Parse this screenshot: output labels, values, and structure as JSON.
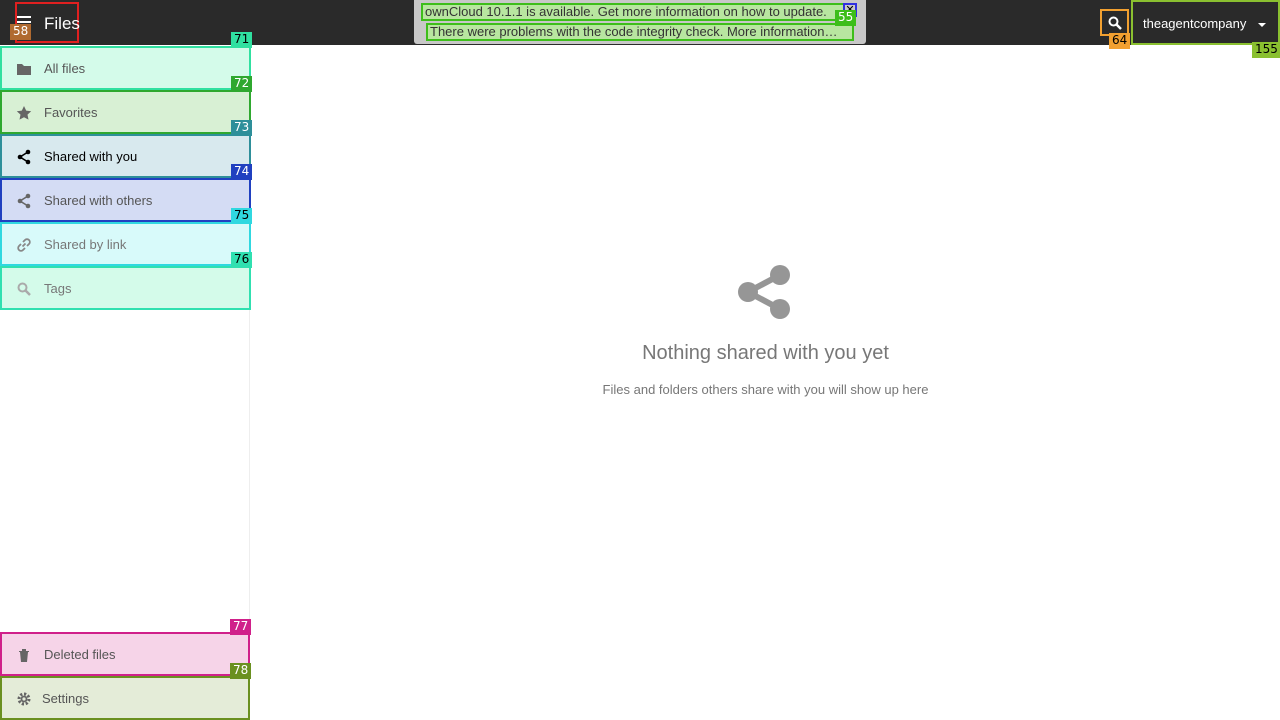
{
  "header": {
    "app_title": "Files",
    "notifications": [
      "ownCloud 10.1.1 is available. Get more information on how to update.",
      "There were problems with the code integrity check. More information…"
    ],
    "close_glyph": "✕",
    "username": "theagentcompany"
  },
  "badges": {
    "app_menu": "58",
    "notif_update": "55",
    "search": "64",
    "user_menu": "155",
    "all_files": "71",
    "favorites": "72",
    "shared_with_you": "73",
    "shared_with_others": "74",
    "shared_by_link": "75",
    "tags": "76",
    "deleted_files": "77",
    "settings": "78"
  },
  "sidebar": {
    "items": [
      {
        "label": "All files",
        "icon": "folder-icon"
      },
      {
        "label": "Favorites",
        "icon": "star-icon"
      },
      {
        "label": "Shared with you",
        "icon": "share-icon"
      },
      {
        "label": "Shared with others",
        "icon": "share-icon"
      },
      {
        "label": "Shared by link",
        "icon": "link-icon"
      },
      {
        "label": "Tags",
        "icon": "search-icon"
      }
    ],
    "bottom_items": [
      {
        "label": "Deleted files",
        "icon": "trash-icon"
      },
      {
        "label": "Settings",
        "icon": "gear-icon"
      }
    ]
  },
  "main": {
    "empty_title": "Nothing shared with you yet",
    "empty_subtitle": "Files and folders others share with you will show up here"
  },
  "colors": {
    "topbar": "#2a2a2a",
    "active_item_bg": "#d8e9ee"
  }
}
